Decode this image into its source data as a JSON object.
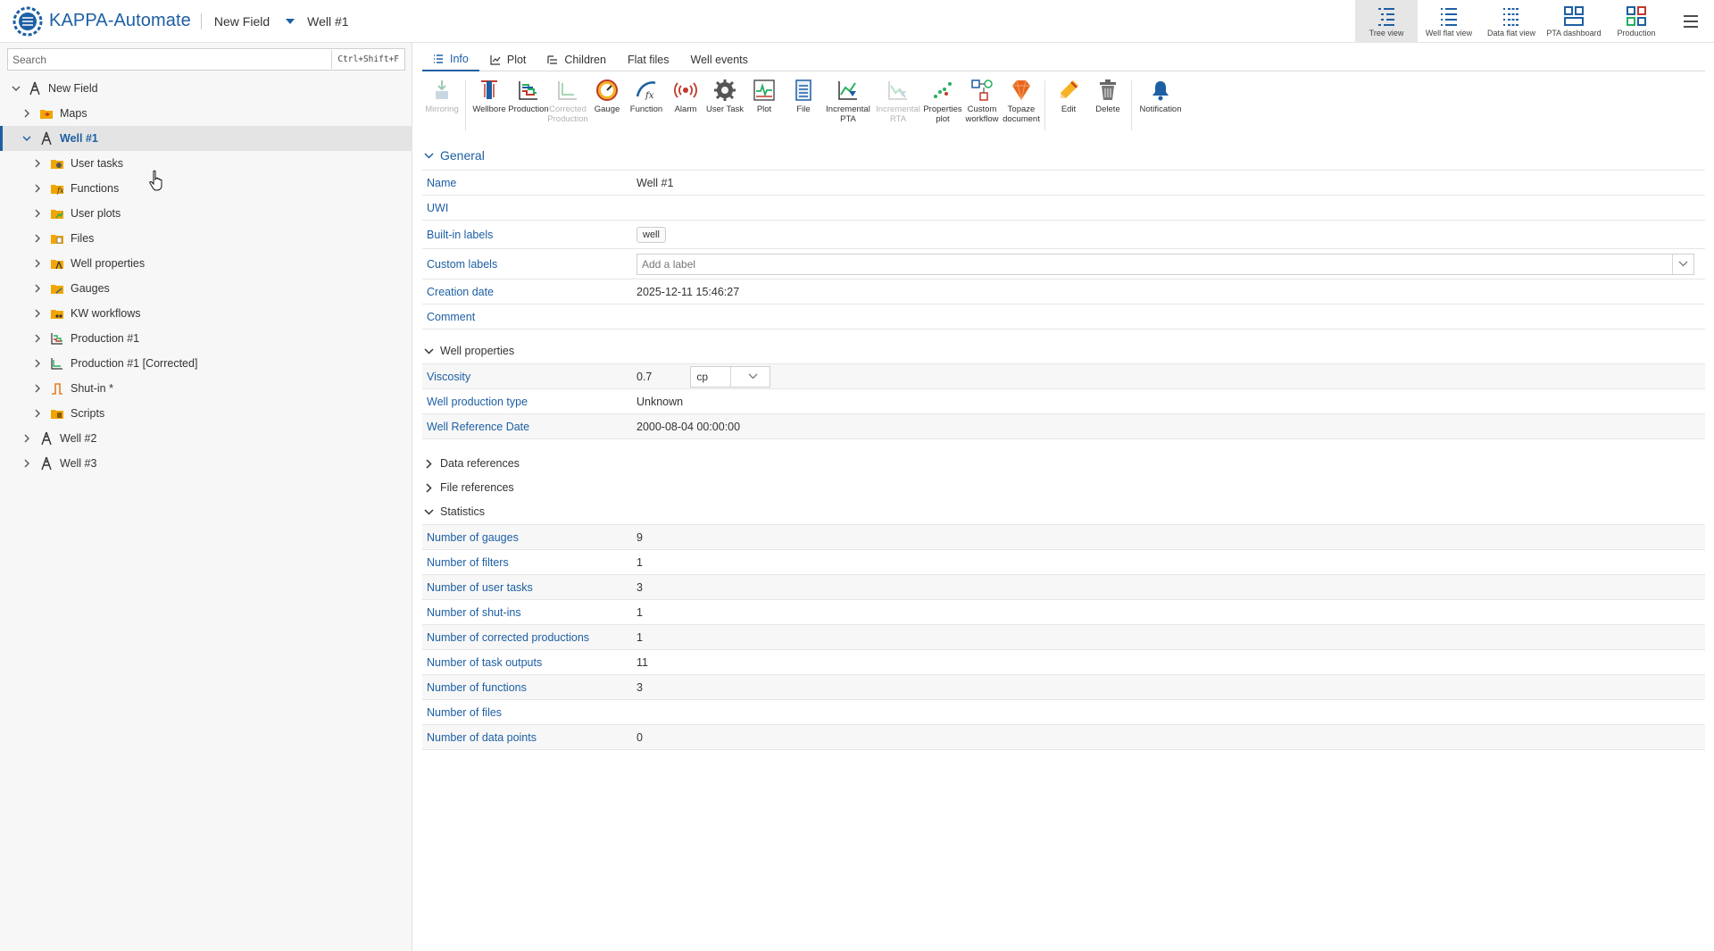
{
  "header": {
    "app_title": "KAPPA-Automate",
    "breadcrumb_field": "New Field",
    "breadcrumb_well": "Well #1",
    "views": [
      {
        "label": "Tree view",
        "icon": "tree-view-icon",
        "active": true
      },
      {
        "label": "Well flat view",
        "icon": "well-flat-view-icon",
        "active": false
      },
      {
        "label": "Data flat view",
        "icon": "data-flat-view-icon",
        "active": false
      },
      {
        "label": "PTA dashboard",
        "icon": "pta-dashboard-icon",
        "active": false
      },
      {
        "label": "Production",
        "icon": "production-dashboard-icon",
        "active": false
      }
    ]
  },
  "sidebar": {
    "search_placeholder": "Search",
    "search_shortcut": "Ctrl+Shift+F",
    "tree": [
      {
        "label": "New Field",
        "icon": "field-icon",
        "expanded": true,
        "depth": 0
      },
      {
        "label": "Maps",
        "icon": "maps-folder-icon",
        "expanded": false,
        "depth": 1
      },
      {
        "label": "Well #1",
        "icon": "well-icon",
        "expanded": true,
        "depth": 1,
        "selected": true
      },
      {
        "label": "User tasks",
        "icon": "user-tasks-folder-icon",
        "expanded": false,
        "depth": 2
      },
      {
        "label": "Functions",
        "icon": "functions-folder-icon",
        "expanded": false,
        "depth": 2
      },
      {
        "label": "User plots",
        "icon": "user-plots-folder-icon",
        "expanded": false,
        "depth": 2
      },
      {
        "label": "Files",
        "icon": "files-folder-icon",
        "expanded": false,
        "depth": 2
      },
      {
        "label": "Well properties",
        "icon": "well-properties-folder-icon",
        "expanded": false,
        "depth": 2
      },
      {
        "label": "Gauges",
        "icon": "gauges-folder-icon",
        "expanded": false,
        "depth": 2
      },
      {
        "label": "KW workflows",
        "icon": "kw-workflows-folder-icon",
        "expanded": false,
        "depth": 2
      },
      {
        "label": "Production #1",
        "icon": "production-icon",
        "expanded": false,
        "depth": 2
      },
      {
        "label": "Production #1 [Corrected]",
        "icon": "corrected-production-icon",
        "expanded": false,
        "depth": 2
      },
      {
        "label": "Shut-in *",
        "icon": "shut-in-icon",
        "expanded": false,
        "depth": 2
      },
      {
        "label": "Scripts",
        "icon": "scripts-folder-icon",
        "expanded": false,
        "depth": 2
      },
      {
        "label": "Well #2",
        "icon": "well-icon",
        "expanded": false,
        "depth": 1
      },
      {
        "label": "Well #3",
        "icon": "well-icon",
        "expanded": false,
        "depth": 1
      }
    ]
  },
  "tabs": [
    {
      "label": "Info",
      "icon": "list-icon",
      "active": true
    },
    {
      "label": "Plot",
      "icon": "line-chart-icon",
      "active": false
    },
    {
      "label": "Children",
      "icon": "children-icon",
      "active": false
    },
    {
      "label": "Flat files",
      "icon": "",
      "active": false
    },
    {
      "label": "Well events",
      "icon": "",
      "active": false
    }
  ],
  "toolbar": [
    {
      "label": "Mirroring",
      "icon": "mirroring-icon",
      "disabled": true
    },
    {
      "label": "Wellbore",
      "icon": "wellbore-icon",
      "disabled": false
    },
    {
      "label": "Production",
      "icon": "production-tool-icon",
      "disabled": false
    },
    {
      "label": "Corrected Production",
      "icon": "corrected-production-tool-icon",
      "disabled": true
    },
    {
      "label": "Gauge",
      "icon": "gauge-icon",
      "disabled": false
    },
    {
      "label": "Function",
      "icon": "function-icon",
      "disabled": false
    },
    {
      "label": "Alarm",
      "icon": "alarm-icon",
      "disabled": false
    },
    {
      "label": "User Task",
      "icon": "user-task-icon",
      "disabled": false
    },
    {
      "label": "Plot",
      "icon": "plot-icon",
      "disabled": false
    },
    {
      "label": "File",
      "icon": "file-icon",
      "disabled": false
    },
    {
      "label": "Incremental PTA",
      "icon": "incremental-pta-icon",
      "disabled": false
    },
    {
      "label": "Incremental RTA",
      "icon": "incremental-rta-icon",
      "disabled": true
    },
    {
      "label": "Properties plot",
      "icon": "properties-plot-icon",
      "disabled": false
    },
    {
      "label": "Custom workflow",
      "icon": "custom-workflow-icon",
      "disabled": false
    },
    {
      "label": "Topaze document",
      "icon": "topaze-document-icon",
      "disabled": false
    },
    {
      "label": "Edit",
      "icon": "edit-pencil-icon",
      "disabled": false
    },
    {
      "label": "Delete",
      "icon": "delete-trash-icon",
      "disabled": false
    },
    {
      "label": "Notification",
      "icon": "notification-bell-icon",
      "disabled": false
    }
  ],
  "general": {
    "title": "General",
    "name_label": "Name",
    "name_value": "Well #1",
    "uwi_label": "UWI",
    "uwi_value": "",
    "builtin_labels_label": "Built-in labels",
    "builtin_label_chip": "well",
    "custom_labels_label": "Custom labels",
    "custom_labels_placeholder": "Add a label",
    "creation_date_label": "Creation date",
    "creation_date_value": "2025-12-11 15:46:27",
    "comment_label": "Comment",
    "comment_value": ""
  },
  "well_properties": {
    "title": "Well properties",
    "viscosity_label": "Viscosity",
    "viscosity_value": "0.7",
    "viscosity_unit": "cp",
    "production_type_label": "Well production type",
    "production_type_value": "Unknown",
    "reference_date_label": "Well Reference Date",
    "reference_date_value": "2000-08-04 00:00:00"
  },
  "collapsed_sections": {
    "data_references": "Data references",
    "file_references": "File references"
  },
  "statistics": {
    "title": "Statistics",
    "rows": [
      {
        "label": "Number of gauges",
        "value": "9"
      },
      {
        "label": "Number of filters",
        "value": "1"
      },
      {
        "label": "Number of user tasks",
        "value": "3"
      },
      {
        "label": "Number of shut-ins",
        "value": "1"
      },
      {
        "label": "Number of corrected productions",
        "value": "1"
      },
      {
        "label": "Number of task outputs",
        "value": "11"
      },
      {
        "label": "Number of functions",
        "value": "3"
      },
      {
        "label": "Number of files",
        "value": ""
      },
      {
        "label": "Number of data points",
        "value": "0"
      }
    ]
  },
  "colors": {
    "accent": "#1d5fa3",
    "sidebar_bg": "#f7f7f7",
    "selected_row": "#e4e4e4",
    "orange_folder": "#f0a500"
  }
}
